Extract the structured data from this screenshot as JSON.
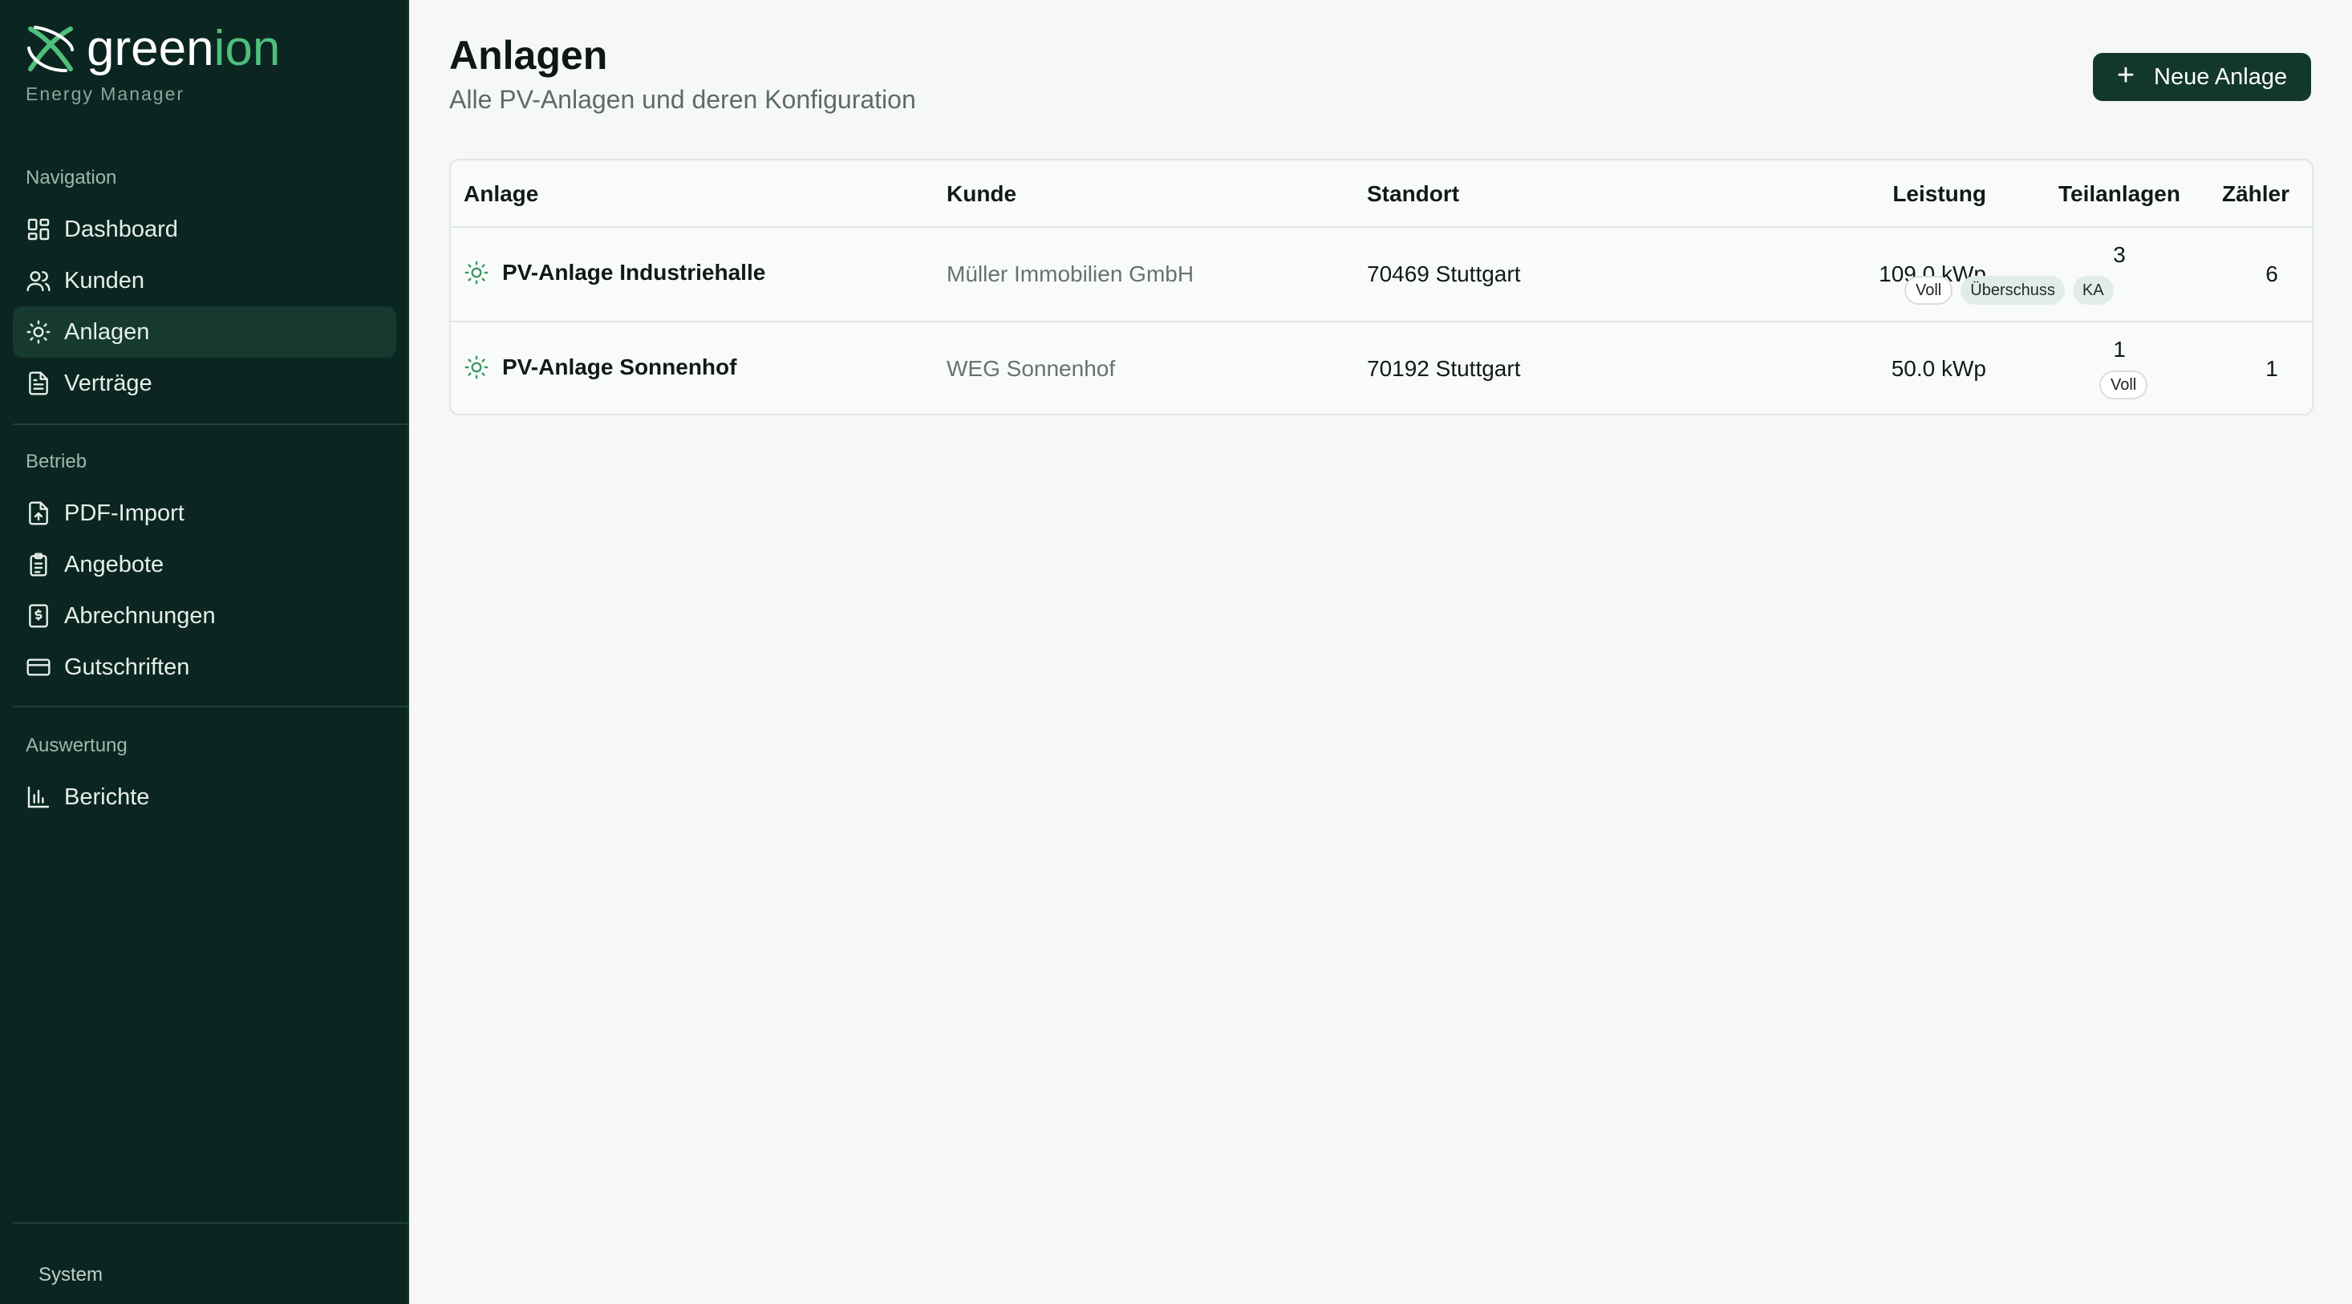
{
  "brand": {
    "name_a": "green",
    "name_b": "ion",
    "subtitle": "Energy Manager"
  },
  "colors": {
    "sidebar_bg": "#0b2620",
    "accent": "#4fbf7c",
    "button_bg": "#12382d"
  },
  "sidebar": {
    "sections": [
      {
        "label": "Navigation",
        "items": [
          {
            "label": "Dashboard",
            "icon": "grid-icon"
          },
          {
            "label": "Kunden",
            "icon": "users-icon"
          },
          {
            "label": "Anlagen",
            "icon": "sun-icon",
            "active": true
          },
          {
            "label": "Verträge",
            "icon": "document-icon"
          }
        ]
      },
      {
        "label": "Betrieb",
        "items": [
          {
            "label": "PDF-Import",
            "icon": "file-upload-icon"
          },
          {
            "label": "Angebote",
            "icon": "clipboard-list-icon"
          },
          {
            "label": "Abrechnungen",
            "icon": "invoice-icon"
          },
          {
            "label": "Gutschriften",
            "icon": "credit-card-icon"
          }
        ]
      },
      {
        "label": "Auswertung",
        "items": [
          {
            "label": "Berichte",
            "icon": "bar-chart-icon"
          }
        ]
      }
    ],
    "footer_label": "System"
  },
  "page": {
    "title": "Anlagen",
    "subtitle": "Alle PV-Anlagen und deren Konfiguration",
    "new_button_label": "Neue Anlage"
  },
  "table": {
    "headers": [
      "Anlage",
      "Kunde",
      "Standort",
      "Leistung",
      "Teilanlagen",
      "Zähler"
    ],
    "rows": [
      {
        "anlage": "PV-Anlage Industriehalle",
        "kunde": "Müller Immobilien GmbH",
        "standort": "70469 Stuttgart",
        "leistung": "109.0 kWp",
        "teilanlagen": "3",
        "badges": [
          "Voll",
          "Überschuss",
          "KA"
        ],
        "zaehler": "6"
      },
      {
        "anlage": "PV-Anlage Sonnenhof",
        "kunde": "WEG Sonnenhof",
        "standort": "70192 Stuttgart",
        "leistung": "50.0 kWp",
        "teilanlagen": "1",
        "badges": [
          "Voll"
        ],
        "zaehler": "1"
      }
    ]
  }
}
